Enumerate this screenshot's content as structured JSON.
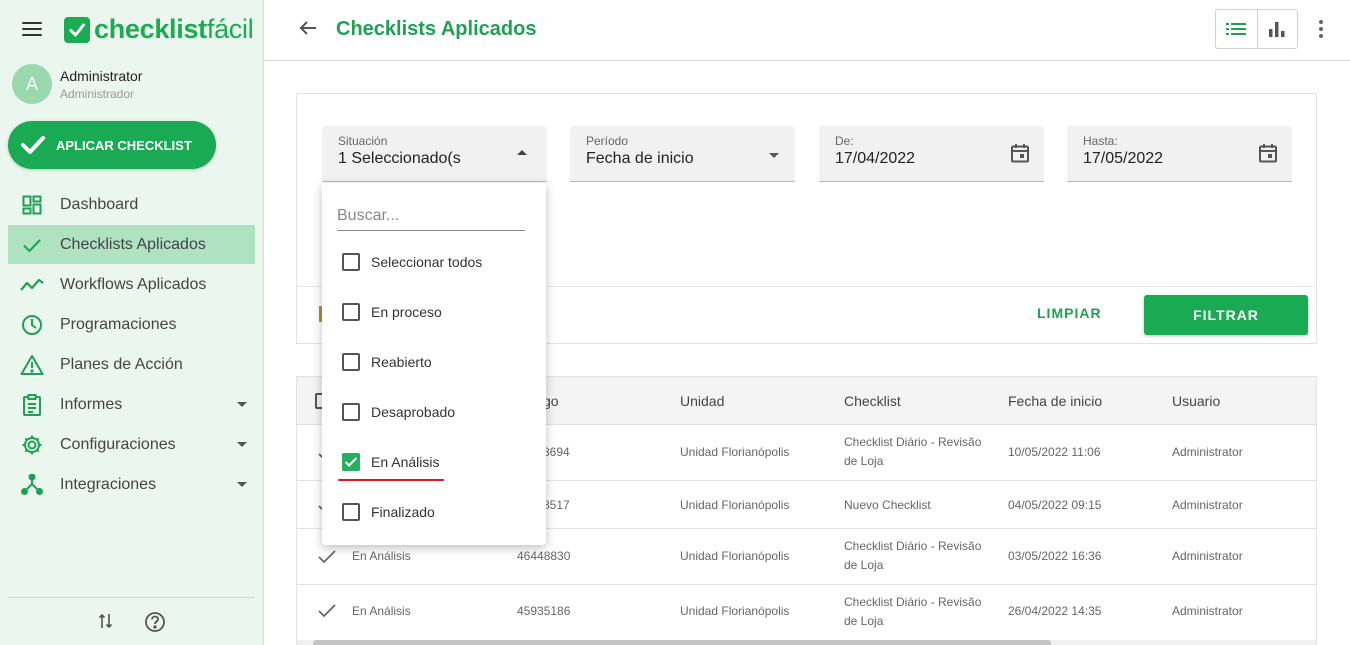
{
  "brand": {
    "name_bold": "checklist",
    "name_light": "fácil",
    "color": "#1bab52"
  },
  "user": {
    "initial": "A",
    "name": "Administrator",
    "role": "Administrador"
  },
  "sidebar": {
    "apply_button": "APLICAR CHECKLIST",
    "items": [
      {
        "label": "Dashboard",
        "icon": "dashboard-icon"
      },
      {
        "label": "Checklists Aplicados",
        "icon": "check-icon",
        "active": true
      },
      {
        "label": "Workflows Aplicados",
        "icon": "trending-icon"
      },
      {
        "label": "Programaciones",
        "icon": "clock-icon"
      },
      {
        "label": "Planes de Acción",
        "icon": "warning-icon"
      },
      {
        "label": "Informes",
        "icon": "clipboard-icon",
        "expandable": true
      },
      {
        "label": "Configuraciones",
        "icon": "gear-icon",
        "expandable": true
      },
      {
        "label": "Integraciones",
        "icon": "integration-icon",
        "expandable": true
      }
    ]
  },
  "header": {
    "title": "Checklists Aplicados"
  },
  "filters": {
    "situacion": {
      "label": "Situación",
      "value": "1 Seleccionado(s"
    },
    "periodo": {
      "label": "Período",
      "value": "Fecha de inicio"
    },
    "de": {
      "label": "De:",
      "value": "17/04/2022"
    },
    "hasta": {
      "label": "Hasta:",
      "value": "17/05/2022"
    },
    "clear_label": "LIMPIAR",
    "apply_label": "FILTRAR"
  },
  "dropdown": {
    "search_placeholder": "Buscar...",
    "options": [
      {
        "label": "Seleccionar todos",
        "checked": false
      },
      {
        "label": "En proceso",
        "checked": false
      },
      {
        "label": "Reabierto",
        "checked": false
      },
      {
        "label": "Desaprobado",
        "checked": false
      },
      {
        "label": "En Análisis",
        "checked": true
      },
      {
        "label": "Finalizado",
        "checked": false
      }
    ]
  },
  "table": {
    "headers": [
      "go",
      "Unidad",
      "Checklist",
      "Fecha de inicio",
      "Usuario"
    ],
    "rows": [
      {
        "status": "",
        "code": "8694",
        "unit": "Unidad Florianópolis",
        "checklist_line1": "Checklist Diário - Revisão",
        "checklist_line2": "de Loja",
        "date": "10/05/2022 11:06",
        "user": "Administrator"
      },
      {
        "status": "",
        "code": "8517",
        "unit": "Unidad Florianópolis",
        "checklist_line1": "Nuevo Checklist",
        "checklist_line2": "",
        "date": "04/05/2022 09:15",
        "user": "Administrator"
      },
      {
        "status": "En Análisis",
        "code": "46448830",
        "unit": "Unidad Florianópolis",
        "checklist_line1": "Checklist Diário - Revisão",
        "checklist_line2": "de Loja",
        "date": "03/05/2022 16:36",
        "user": "Administrator"
      },
      {
        "status": "En Análisis",
        "code": "45935186",
        "unit": "Unidad Florianópolis",
        "checklist_line1": "Checklist Diário - Revisão",
        "checklist_line2": "de Loja",
        "date": "26/04/2022 14:35",
        "user": "Administrator"
      }
    ]
  }
}
